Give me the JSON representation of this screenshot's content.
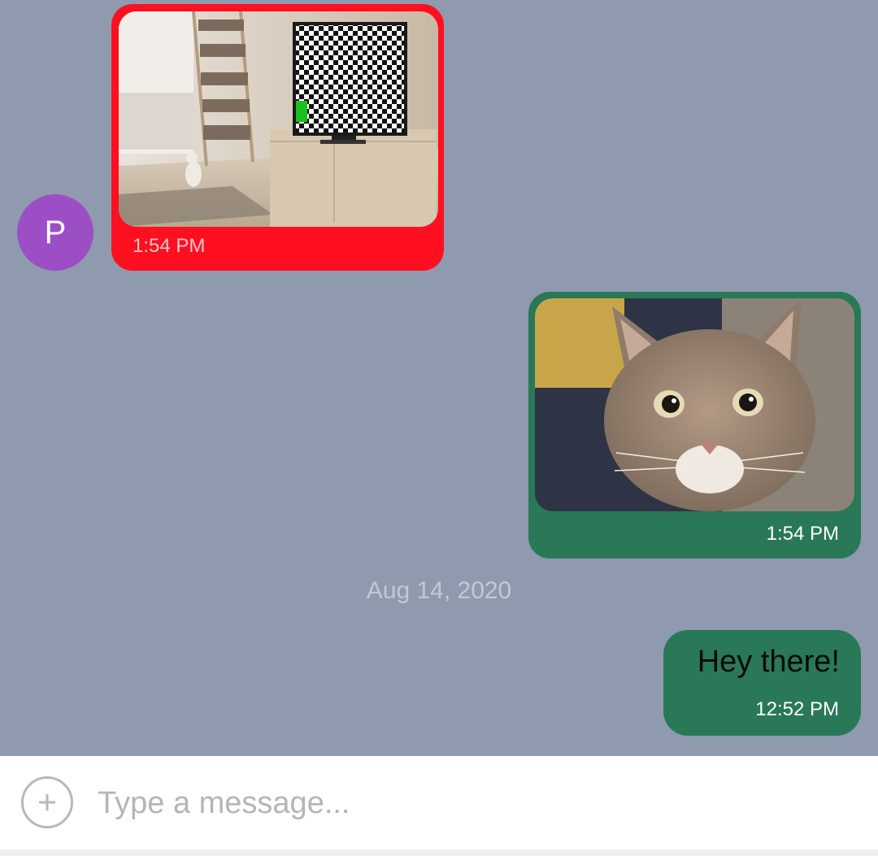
{
  "thread": {
    "date_separator": "Aug 14, 2020",
    "messages": [
      {
        "direction": "incoming",
        "kind": "image",
        "sender_initial": "P",
        "image_description_icon": "photo-living-room-tv",
        "time": "1:54 PM",
        "bubble_color": "#ff0f20",
        "avatar_color": "#9c4fc4"
      },
      {
        "direction": "outgoing",
        "kind": "image",
        "image_description_icon": "photo-cat",
        "time": "1:54 PM",
        "bubble_color": "#297857"
      },
      {
        "direction": "outgoing",
        "kind": "text",
        "text": "Hey there!",
        "time": "12:52 PM",
        "bubble_color": "#297857"
      }
    ]
  },
  "composer": {
    "placeholder": "Type a message...",
    "value": "",
    "add_icon": "plus-circle-icon"
  },
  "colors": {
    "background": "#8f9aae",
    "composer_background": "#ffffff"
  }
}
